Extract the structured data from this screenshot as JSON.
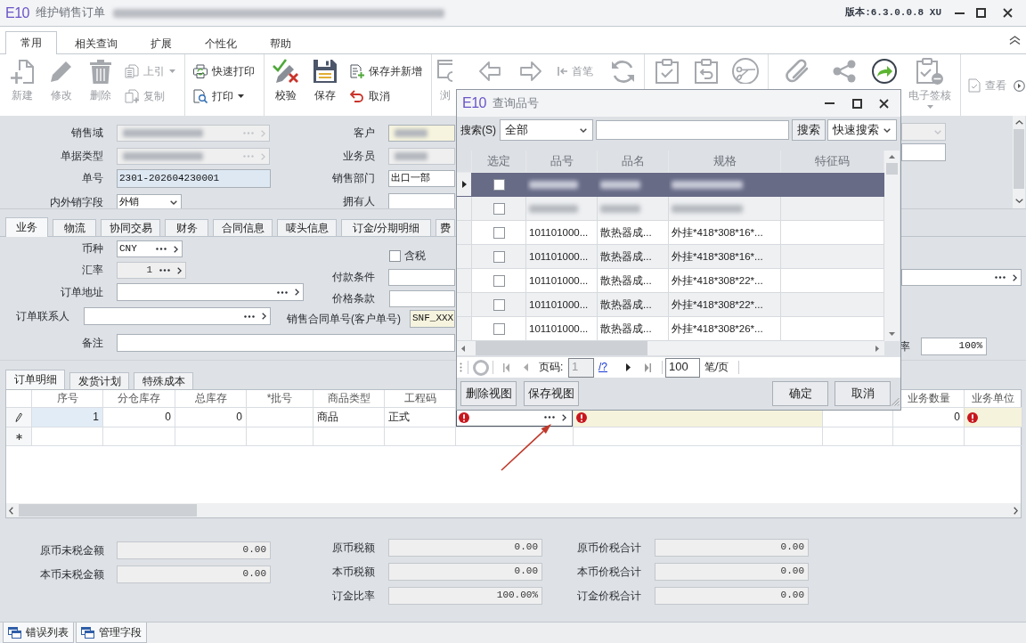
{
  "window": {
    "logo": "E10",
    "title": "维护销售订单",
    "title_redacted": true,
    "version": "版本:6.3.0.0.8 XU"
  },
  "ribbon": {
    "tabs": [
      {
        "label": "常用",
        "selected": true
      },
      {
        "label": "相关查询",
        "selected": false
      },
      {
        "label": "扩展",
        "selected": false
      },
      {
        "label": "个性化",
        "selected": false
      },
      {
        "label": "帮助",
        "selected": false
      }
    ],
    "groups": [
      [
        {
          "kind": "large",
          "label": "新建",
          "disabled": true,
          "dropdown": false
        },
        {
          "kind": "large",
          "label": "修改",
          "disabled": true,
          "dropdown": false
        },
        {
          "kind": "large",
          "label": "删除",
          "disabled": true,
          "dropdown": false
        },
        {
          "kind": "stack",
          "items": [
            {
              "label": "上引",
              "disabled": true,
              "dropdown": true
            },
            {
              "label": "复制",
              "disabled": true,
              "dropdown": false
            }
          ]
        }
      ],
      [
        {
          "kind": "stack",
          "items": [
            {
              "label": "快速打印",
              "disabled": false,
              "dropdown": false
            },
            {
              "label": "打印",
              "disabled": false,
              "dropdown": true
            }
          ]
        }
      ],
      [
        {
          "kind": "large",
          "label": "校验",
          "disabled": false,
          "dropdown": false
        },
        {
          "kind": "large",
          "label": "保存",
          "disabled": false,
          "dropdown": false
        },
        {
          "kind": "stack",
          "items": [
            {
              "label": "保存并新增",
              "disabled": false,
              "dropdown": false
            },
            {
              "label": "取消",
              "disabled": false,
              "dropdown": false
            }
          ]
        }
      ],
      [
        {
          "kind": "large",
          "label": "浏",
          "disabled": true,
          "dropdown": false
        },
        {
          "kind": "icon",
          "disabled": true,
          "dropdown": false
        },
        {
          "kind": "icon",
          "disabled": true,
          "dropdown": false
        },
        {
          "kind": "small",
          "label": "首笔",
          "disabled": true,
          "dropdown": false
        },
        {
          "kind": "icon",
          "disabled": true,
          "dropdown": false
        }
      ],
      [
        {
          "kind": "icon",
          "disabled": true,
          "dropdown": false
        },
        {
          "kind": "icon",
          "disabled": true,
          "dropdown": false
        },
        {
          "kind": "icon",
          "disabled": true,
          "dropdown": false
        }
      ],
      [
        {
          "kind": "icon",
          "disabled": true,
          "dropdown": false
        },
        {
          "kind": "icon",
          "disabled": true,
          "dropdown": false
        },
        {
          "kind": "icon",
          "disabled": false,
          "dropdown": false
        },
        {
          "kind": "large",
          "label": "电子签核",
          "disabled": true,
          "dropdown": true
        }
      ],
      [
        {
          "kind": "small",
          "label": "查看",
          "disabled": true,
          "dropdown": false
        }
      ]
    ]
  },
  "header": {
    "rows": [
      [
        {
          "label": "销售域",
          "kind": "lookup",
          "disabled": true,
          "required": false,
          "highlighted": false,
          "redacted": true
        },
        {
          "label": "客户",
          "kind": "text",
          "disabled": false,
          "required": true,
          "highlighted": false,
          "redacted": true
        },
        {
          "kind": "select",
          "disabled": true,
          "required": false,
          "highlighted": false,
          "redacted": false
        }
      ],
      [
        {
          "label": "单据类型",
          "kind": "lookup",
          "disabled": true,
          "required": false,
          "highlighted": false,
          "redacted": true
        },
        {
          "label": "业务员",
          "kind": "text",
          "disabled": true,
          "required": false,
          "highlighted": false,
          "redacted": true
        },
        {
          "kind": "text",
          "disabled": false,
          "required": false,
          "highlighted": false,
          "redacted": false
        }
      ],
      [
        {
          "label": "单号",
          "kind": "text",
          "disabled": false,
          "required": false,
          "highlighted": true,
          "redacted": false,
          "value": "2301-202604230001"
        },
        {
          "label": "销售部门",
          "kind": "text",
          "disabled": false,
          "required": false,
          "highlighted": false,
          "redacted": false,
          "value": "出口一部"
        }
      ],
      [
        {
          "label": "内外销字段",
          "kind": "select",
          "disabled": false,
          "required": false,
          "highlighted": false,
          "redacted": false,
          "value": "外销"
        },
        {
          "label": "拥有人",
          "kind": "text",
          "disabled": false,
          "required": false,
          "highlighted": false,
          "redacted": false
        }
      ]
    ]
  },
  "detail_tabs": [
    {
      "label": "业务",
      "selected": true
    },
    {
      "label": "物流",
      "selected": false
    },
    {
      "label": "协同交易",
      "selected": false
    },
    {
      "label": "财务",
      "selected": false
    },
    {
      "label": "合同信息",
      "selected": false
    },
    {
      "label": "唛头信息",
      "selected": false
    },
    {
      "label": "订金/分期明细",
      "selected": false
    },
    {
      "label": "费",
      "selected": false
    }
  ],
  "business": {
    "rows": [
      [
        {
          "label": "币种",
          "kind": "lookup",
          "disabled": false,
          "required": false,
          "value": "CNY"
        },
        {
          "label": "含税",
          "kind": "check",
          "checked": false
        }
      ],
      [
        {
          "label": "汇率",
          "kind": "rate",
          "disabled": true,
          "required": false,
          "value": "1"
        },
        {
          "label": "付款条件",
          "kind": "text",
          "disabled": false,
          "required": false
        },
        {
          "kind": "lookup",
          "disabled": false,
          "required": false
        }
      ],
      [
        {
          "label": "订单地址",
          "kind": "lookup",
          "disabled": false,
          "required": false
        },
        {
          "label": "价格条款",
          "kind": "text",
          "disabled": false,
          "required": false
        }
      ],
      [
        {
          "label": "订单联系人",
          "kind": "lookup",
          "disabled": false,
          "required": false
        },
        {
          "label": "销售合同单号(客户单号)",
          "kind": "text",
          "disabled": false,
          "required": true,
          "value": "SNF_XXX"
        }
      ],
      [
        {
          "label": "备注",
          "kind": "text",
          "disabled": false,
          "required": false
        },
        {
          "label": "率",
          "kind": "number",
          "disabled": false,
          "required": false,
          "value": "100%"
        }
      ]
    ]
  },
  "order_tabs": [
    {
      "label": "订单明细",
      "selected": true
    },
    {
      "label": "发货计划",
      "selected": false
    },
    {
      "label": "特殊成本",
      "selected": false
    }
  ],
  "order_grid": {
    "columns_left": [
      "序号",
      "分仓库存",
      "总库存",
      "*批号",
      "商品类型",
      "工程码"
    ],
    "columns_right": [
      "业务数量",
      "业务单位"
    ],
    "rows": [
      {
        "kind": "edit",
        "cells": [
          {
            "value": "1",
            "highlighted": true,
            "required": false,
            "focused": false,
            "error": false
          },
          {
            "value": "0",
            "highlighted": false,
            "required": false,
            "focused": false,
            "error": false
          },
          {
            "value": "0",
            "highlighted": false,
            "required": false,
            "focused": false,
            "error": false
          },
          {
            "highlighted": false,
            "required": false,
            "focused": false,
            "error": false
          },
          {
            "value": "商品",
            "highlighted": false,
            "required": false,
            "focused": false,
            "error": false
          },
          {
            "value": "正式",
            "highlighted": false,
            "required": false,
            "focused": false,
            "error": false
          },
          {
            "highlighted": false,
            "required": false,
            "focused": true,
            "error": true
          },
          {
            "highlighted": false,
            "required": true,
            "focused": false,
            "error": true
          },
          {
            "highlighted": false,
            "required": false,
            "focused": false,
            "error": false
          },
          {
            "value": "0",
            "highlighted": false,
            "required": false,
            "focused": false,
            "error": false
          },
          {
            "highlighted": false,
            "required": true,
            "focused": false,
            "error": true
          }
        ]
      },
      {
        "kind": "new"
      }
    ]
  },
  "totals": {
    "columns": [
      [
        {
          "label": "原币未税金额",
          "kind": "number",
          "disabled": true,
          "value": "0.00"
        },
        {
          "label": "本币未税金额",
          "kind": "number",
          "disabled": true,
          "value": "0.00"
        }
      ],
      [
        {
          "label": "原币税额",
          "kind": "number",
          "disabled": true,
          "value": "0.00"
        },
        {
          "label": "本币税额",
          "kind": "number",
          "disabled": true,
          "value": "0.00"
        },
        {
          "label": "订金比率",
          "kind": "number",
          "disabled": true,
          "value": "100.00%"
        }
      ],
      [
        {
          "label": "原币价税合计",
          "kind": "number",
          "disabled": true,
          "value": "0.00"
        },
        {
          "label": "本币价税合计",
          "kind": "number",
          "disabled": true,
          "value": "0.00"
        },
        {
          "label": "订金价税合计",
          "kind": "number",
          "disabled": true,
          "value": "0.00"
        }
      ]
    ]
  },
  "bottom_tabs": [
    {
      "label": "错误列表"
    },
    {
      "label": "管理字段"
    }
  ],
  "dialog": {
    "logo": "E10",
    "title": "查询品号",
    "search": {
      "label": "搜索(S)",
      "scope": "全部",
      "button": "搜索",
      "mode": "快速搜索"
    },
    "columns": [
      "选定",
      "品号",
      "品名",
      "规格",
      "特征码"
    ],
    "rows": [
      {
        "selected": true,
        "checked": false,
        "redacted": true
      },
      {
        "selected": false,
        "checked": false,
        "redacted": true
      },
      {
        "selected": false,
        "checked": false,
        "redacted": false,
        "item_no": "101101000...",
        "item_name": "散热器成...",
        "spec": "外挂*418*308*16*..."
      },
      {
        "selected": false,
        "checked": false,
        "redacted": false,
        "item_no": "101101000...",
        "item_name": "散热器成...",
        "spec": "外挂*418*308*16*..."
      },
      {
        "selected": false,
        "checked": false,
        "redacted": false,
        "item_no": "101101000...",
        "item_name": "散热器成...",
        "spec": "外挂*418*308*22*..."
      },
      {
        "selected": false,
        "checked": false,
        "redacted": false,
        "item_no": "101101000...",
        "item_name": "散热器成...",
        "spec": "外挂*418*308*22*..."
      },
      {
        "selected": false,
        "checked": false,
        "redacted": false,
        "item_no": "101101000...",
        "item_name": "散热器成...",
        "spec": "外挂*418*308*26*..."
      }
    ],
    "pager": {
      "page_label": "页码:",
      "page": "1",
      "total_link": "/?",
      "page_size": "100",
      "unit": "笔/页"
    },
    "buttons_left": [
      "删除视图",
      "保存视图"
    ],
    "buttons_right": [
      "确定",
      "取消"
    ]
  },
  "annotations": [
    {
      "kind": "arrow"
    }
  ]
}
